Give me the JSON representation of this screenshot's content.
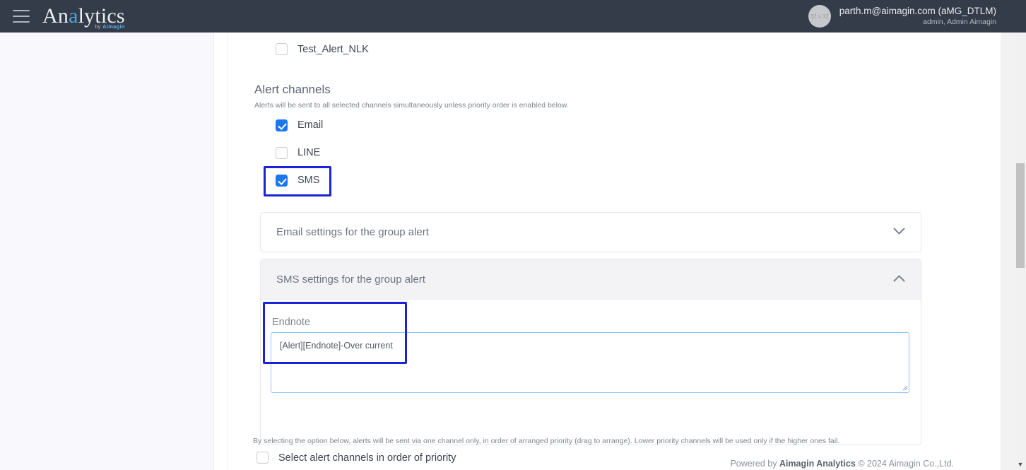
{
  "header": {
    "menu_icon": "hamburger-icon",
    "logo_prefix": "An",
    "logo_highlight": "a",
    "logo_suffix": "lytics",
    "logo_sub_by": "by ",
    "logo_sub_brand": "Aimagin",
    "avatar_placeholder": "32 x 32",
    "user_email": "parth.m@aimagin.com (aMG_DTLM)",
    "user_role": "admin, Admin Aimagin"
  },
  "top_list": {
    "item_label": "Test_Alert_NLK",
    "item_checked": false
  },
  "alert_channels": {
    "title": "Alert channels",
    "description": "Alerts will be sent to all selected channels simultaneously unless priority order is enabled below.",
    "items": [
      {
        "label": "Email",
        "checked": true
      },
      {
        "label": "LINE",
        "checked": false
      },
      {
        "label": "SMS",
        "checked": true
      }
    ]
  },
  "accordions": {
    "email": {
      "title": "Email settings for the group alert",
      "chevron": "⌄",
      "expanded": false
    },
    "sms": {
      "title": "SMS settings for the group alert",
      "chevron": "⌃",
      "expanded": true
    }
  },
  "sms_settings": {
    "endnote_label": "Endnote",
    "endnote_value": "[Alert][Endnote]-Over current",
    "endnote_placeholder": ""
  },
  "priority": {
    "note": "By selecting the option below, alerts will be sent via one channel only, in order of arranged priority (drag to arrange). Lower priority channels will be used only if the higher ones fail.",
    "checkbox_label": "Select alert channels in order of priority",
    "checked": false
  },
  "footer": {
    "prefix": "Powered by ",
    "brand": "Aimagin Analytics",
    "suffix": " © 2024 Aimagin Co.,Ltd."
  },
  "scrollbars": {
    "inner_arrow": "▼",
    "page_arrow": "▼"
  },
  "colors": {
    "header_bg": "#343c4a",
    "accent_checkbox": "#1877f2",
    "annotation": "#1b22d8",
    "focus_border": "#8cc4f5"
  }
}
